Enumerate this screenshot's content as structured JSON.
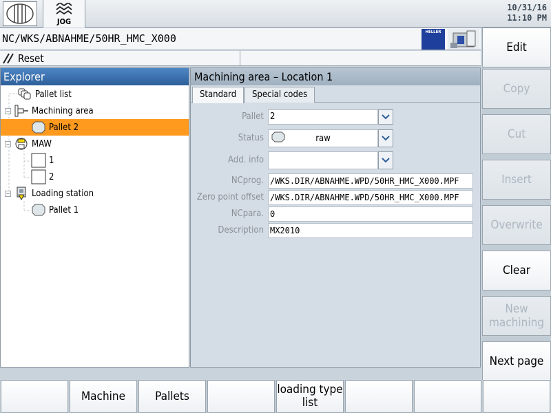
{
  "header": {
    "mode": "JOG",
    "date": "10/31/16",
    "time": "11:10 PM"
  },
  "path": "NC/WKS/ABNAHME/50HR_HMC_X000",
  "logo_text": "HELLER",
  "reset_label": "Reset",
  "explorer": {
    "title": "Explorer",
    "nodes": [
      {
        "label": "Pallet list"
      },
      {
        "label": "Machining area"
      },
      {
        "label": "Pallet 2"
      },
      {
        "label": "MAW"
      },
      {
        "label": "1"
      },
      {
        "label": "2"
      },
      {
        "label": "Loading station"
      },
      {
        "label": "Pallet 1"
      }
    ]
  },
  "detail": {
    "title": "Machining area – Location 1",
    "tabs": [
      {
        "label": "Standard",
        "active": true
      },
      {
        "label": "Special codes",
        "active": false
      }
    ],
    "fields": {
      "pallet": {
        "label": "Pallet",
        "value": "2"
      },
      "status": {
        "label": "Status",
        "value": "raw"
      },
      "add_info": {
        "label": "Add. info",
        "value": ""
      },
      "ncprog": {
        "label": "NCprog.",
        "value": "/WKS.DIR/ABNAHME.WPD/50HR_HMC_X000.MPF"
      },
      "zero_offset": {
        "label": "Zero point offset",
        "value": "/WKS.DIR/ABNAHME.WPD/50HR_HMC_X000.MPF"
      },
      "ncpara": {
        "label": "NCpara.",
        "value": "0"
      },
      "description": {
        "label": "Description",
        "value": "MX2010"
      }
    }
  },
  "vertical_softkeys": [
    {
      "label": "Edit",
      "enabled": true
    },
    {
      "label": "Copy",
      "enabled": false
    },
    {
      "label": "Cut",
      "enabled": false
    },
    {
      "label": "Insert",
      "enabled": false
    },
    {
      "label": "Overwrite",
      "enabled": false
    },
    {
      "label": "Clear",
      "enabled": true
    },
    {
      "label": "New machining",
      "enabled": false
    },
    {
      "label": "Next page",
      "enabled": true
    }
  ],
  "horizontal_softkeys": [
    {
      "label": ""
    },
    {
      "label": "Machine"
    },
    {
      "label": "Pallets"
    },
    {
      "label": ""
    },
    {
      "label": "loading type list"
    },
    {
      "label": ""
    },
    {
      "label": ""
    },
    {
      "label": ""
    }
  ],
  "colors": {
    "selection": "#ff9a1f",
    "explorer_header": "#2d5f9a",
    "heller_blue": "#1f3f9c"
  }
}
